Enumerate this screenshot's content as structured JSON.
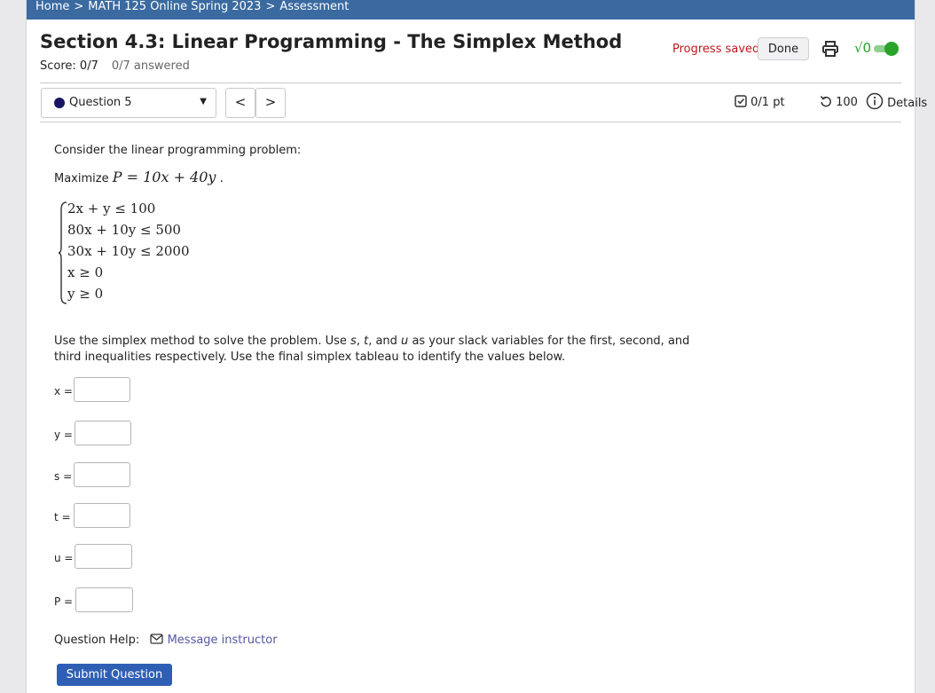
{
  "breadcrumb": {
    "home": "Home",
    "separator": ">",
    "course": "MATH 125 Online Spring 2023",
    "current": "Assessment"
  },
  "header": {
    "title": "Section 4.3: Linear Programming - The Simplex Method",
    "score": "Score: 0/7",
    "answered": "0/7 answered",
    "progress_saved": "Progress saved",
    "done_label": "Done",
    "print_icon": "printer-icon",
    "math_toggle_icon": "sqrt-toggle-icon",
    "math_toggle_glyph": "√0"
  },
  "question_nav": {
    "selected": "Question 5",
    "prev_glyph": "<",
    "next_glyph": ">",
    "points": "0/1 pt",
    "attempts": "100",
    "details": "Details"
  },
  "question": {
    "intro": "Consider the linear programming problem:",
    "maximize_prefix": "Maximize",
    "objective": {
      "lhs": "P",
      "eq": "=",
      "rhs": "10x + 40y"
    },
    "constraints": [
      "2x + y ≤ 100",
      "80x + 10y ≤ 500",
      "30x + 10y ≤ 2000",
      "x ≥ 0",
      "y ≥ 0"
    ],
    "instructions_1": "Use the simplex method to solve the problem. Use",
    "var_s": "s",
    "var_t": "t",
    "var_u": "u",
    "instructions_2": "as your slack variables for the first, second, and third inequalities respectively. Use the final simplex tableau to identify the values below.",
    "fields": [
      {
        "label": "x =",
        "value": ""
      },
      {
        "label": "y =",
        "value": ""
      },
      {
        "label": "s =",
        "value": ""
      },
      {
        "label": "t =",
        "value": ""
      },
      {
        "label": "u =",
        "value": ""
      },
      {
        "label": "P =",
        "value": ""
      }
    ]
  },
  "help": {
    "label": "Question Help:",
    "message": "Message instructor"
  },
  "submit_label": "Submit Question",
  "colors": {
    "topbar": "#3a6aa0",
    "saved": "#c0171d",
    "toggle": "#2aa32a",
    "submit": "#2f5fb5",
    "link": "#5656a8"
  }
}
